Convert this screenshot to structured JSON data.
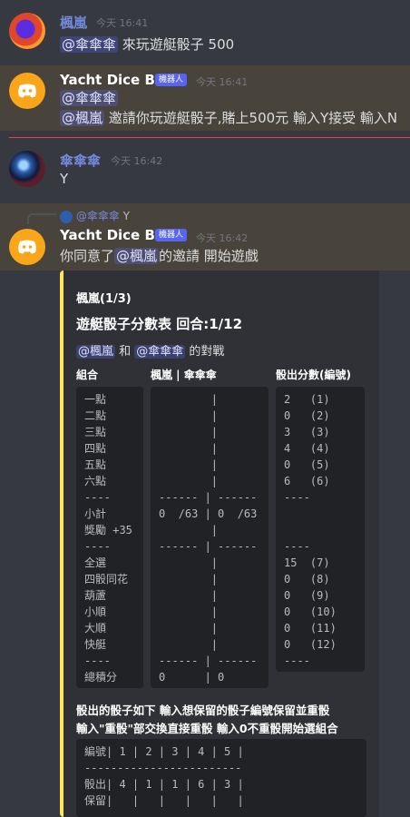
{
  "messages": {
    "m1": {
      "author": "楓嵐",
      "time": "今天 16:41",
      "mention": "@傘傘傘",
      "text": " 來玩遊艇骰子 500"
    },
    "m2": {
      "author": "Yacht Dice Bot",
      "badge": "機器人",
      "time": "今天 16:41",
      "mention1": "@傘傘傘",
      "mention2": "@楓嵐",
      "text": " 邀請你玩遊艇骰子,賭上500元 輸入Y接受 輸入N"
    },
    "m3": {
      "author": "傘傘傘",
      "time": "今天 16:42",
      "text": "Y"
    },
    "m4": {
      "reply_mention": "@傘傘傘",
      "reply_text": "Y",
      "author": "Yacht Dice Bot",
      "badge": "機器人",
      "time": "今天 16:42",
      "text_a": "你同意了",
      "mention": "@楓嵐",
      "text_b": "的邀請 開始遊戲"
    }
  },
  "embed": {
    "author": "楓嵐(1/3)",
    "title": "遊艇骰子分數表 回合:1/12",
    "mention1": "@楓嵐",
    "and": " 和 ",
    "mention2": "@傘傘傘",
    "vs": " 的對戰",
    "field1_title": "組合",
    "field2_title": "楓嵐 | 傘傘傘",
    "field3_title": "骰出分數(編號)",
    "combos": [
      "一點",
      "二點",
      "三點",
      "四點",
      "五點",
      "六點",
      "----",
      "小計",
      "獎勵 +35",
      "----",
      "全選",
      "四骰同花",
      "葫蘆",
      "小順",
      "大順",
      "快艇",
      "----",
      "總積分"
    ],
    "scores": [
      "        |",
      "        |",
      "        |",
      "        |",
      "        |",
      "        |",
      "------ | ------",
      "0  /63 | 0  /63",
      "        |",
      "------ | ------",
      "        |",
      "        |",
      "        |",
      "        |",
      "        |",
      "        |",
      "------ | ------",
      "0      | 0"
    ],
    "rolls": [
      "2   (1)",
      "0   (2)",
      "3   (3)",
      "4   (4)",
      "0   (5)",
      "6   (6)",
      "----",
      "",
      "",
      "----",
      "15  (7)",
      "0   (8)",
      "0   (9)",
      "0   (10)",
      "0   (11)",
      "0   (12)",
      "----"
    ],
    "instr1": "骰出的骰子如下 輸入想保留的骰子編號保留並重骰",
    "instr2": "輸入\"重骰\"部交換直接重骰 輸入0不重骰開始選組合",
    "dice": [
      "編號| 1 | 2 | 3 | 4 | 5 |",
      "------------------------",
      "骰出| 4 | 1 | 1 | 6 | 3 |",
      "保留|   |   |   |   |   |"
    ]
  },
  "colors": {
    "accent": "#fee75c",
    "badge": "#5865f2",
    "mention_bg": "#3c4270",
    "divider": "#ed4245",
    "bot_name": "#ffffff"
  }
}
